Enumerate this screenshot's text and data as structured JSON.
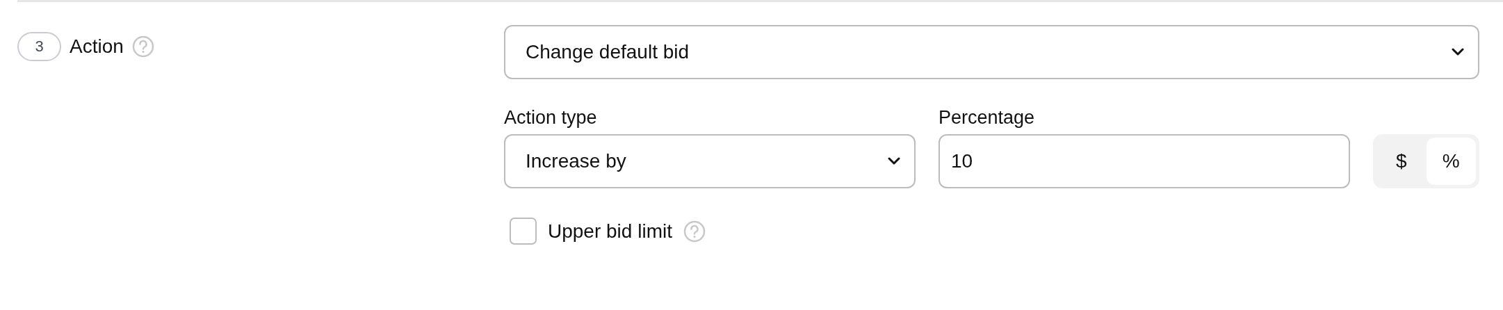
{
  "step": {
    "number": "3",
    "title": "Action"
  },
  "action_select": {
    "value": "Change default bid"
  },
  "action_type": {
    "label": "Action type",
    "value": "Increase by"
  },
  "percentage": {
    "label": "Percentage",
    "value": "10"
  },
  "unit_toggle": [
    {
      "label": "$",
      "selected": false
    },
    {
      "label": "%",
      "selected": true
    }
  ],
  "upper_bid_limit": {
    "label": "Upper bid limit",
    "checked": false
  }
}
